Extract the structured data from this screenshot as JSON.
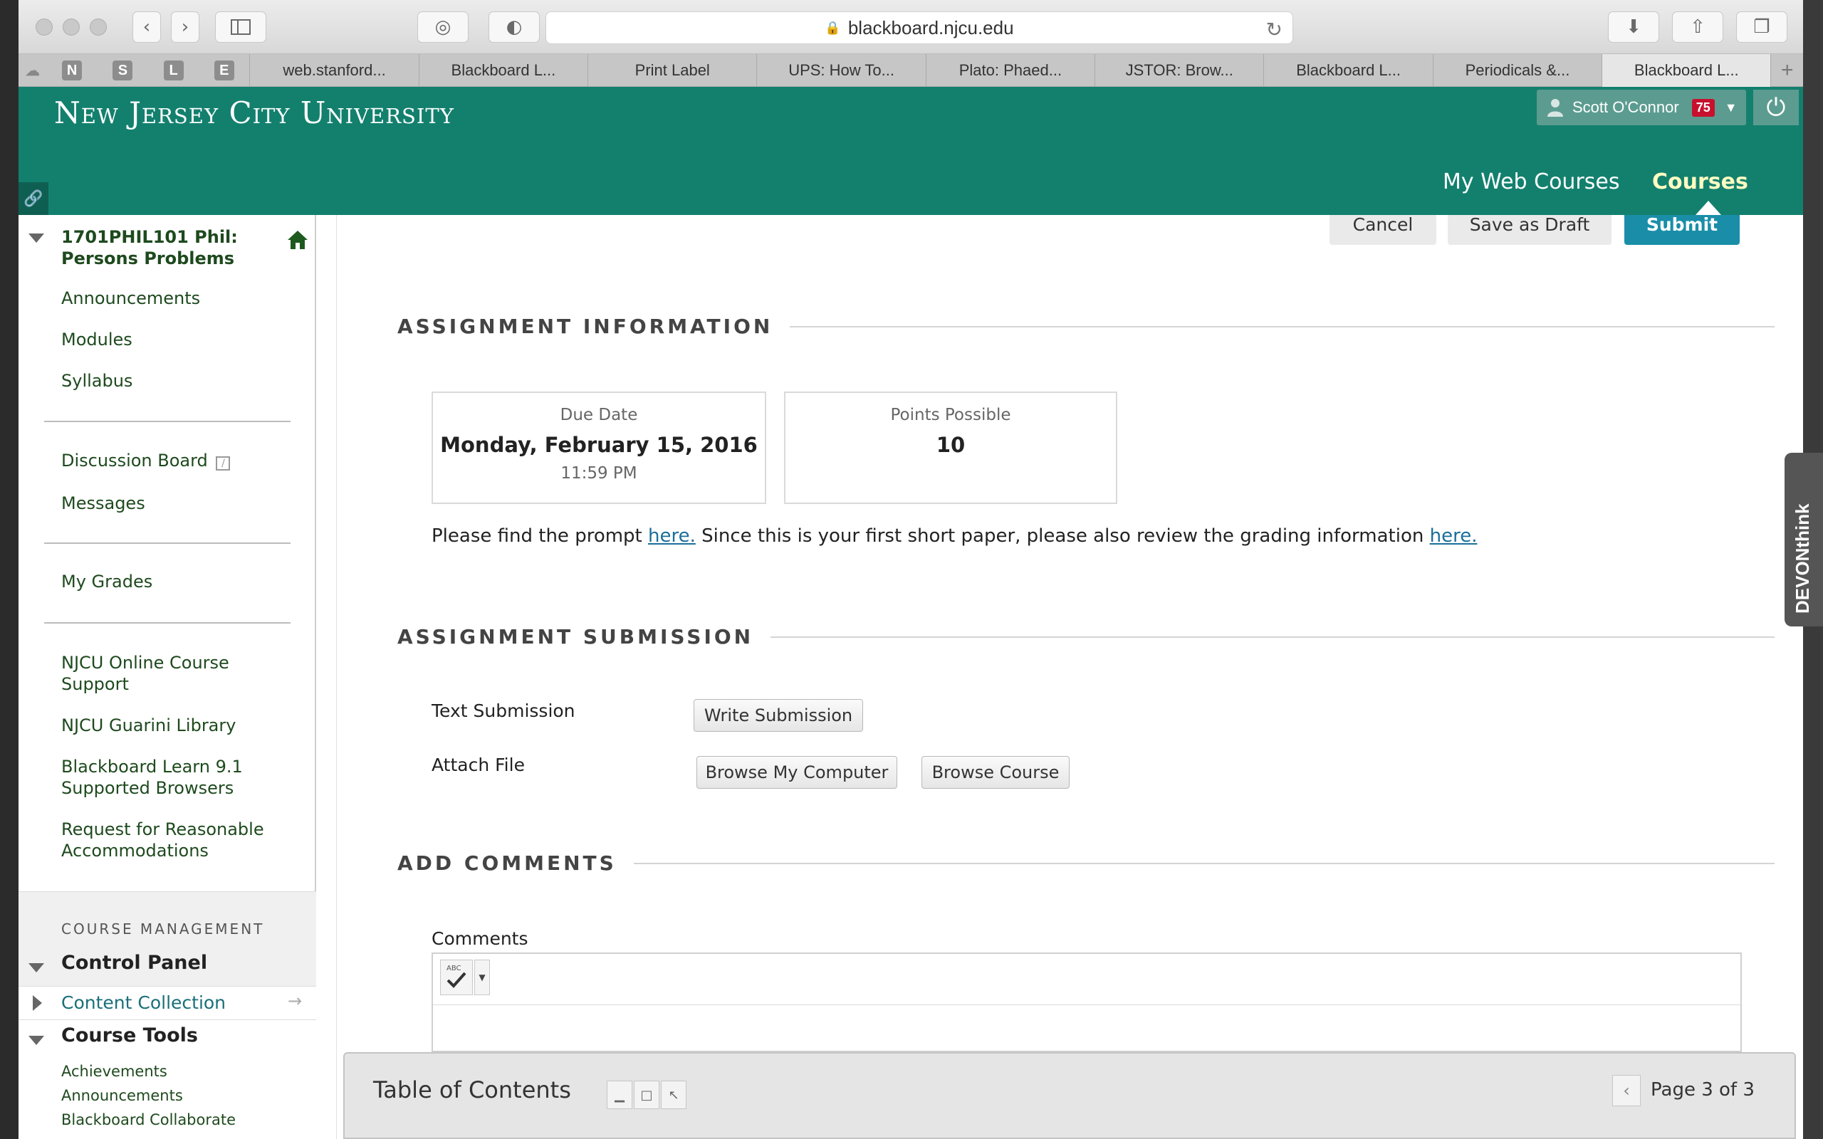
{
  "browser": {
    "url": "blackboard.njcu.edu",
    "pinned_tabs": [
      "N",
      "S",
      "L",
      "E"
    ],
    "tabs": [
      "web.stanford...",
      "Blackboard L...",
      "Print Label",
      "UPS: How To...",
      "Plato: Phaed...",
      "JSTOR: Brow...",
      "Blackboard L...",
      "Periodicals &...",
      "Blackboard L..."
    ],
    "active_tab_index": 8,
    "new_tab_label": "+"
  },
  "banner": {
    "logo": "New Jersey City University",
    "user_name": "Scott O'Connor",
    "notification_count": "75",
    "nav": [
      "My Web Courses",
      "Courses"
    ],
    "active_nav": "Courses",
    "brand_color": "#13806e"
  },
  "sidebar": {
    "course_title": "1701PHIL101 Phil: Persons Problems",
    "group1": [
      "Announcements",
      "Modules",
      "Syllabus"
    ],
    "group2": [
      "Discussion Board",
      "Messages"
    ],
    "group3": [
      "My Grades"
    ],
    "group4": [
      "NJCU Online Course Support",
      "NJCU Guarini Library",
      "Blackboard Learn 9.1 Supported Browsers",
      "Request for Reasonable Accommodations"
    ],
    "management_label": "COURSE MANAGEMENT",
    "control_panel": "Control Panel",
    "content_collection": "Content Collection",
    "course_tools": "Course Tools",
    "tools": [
      "Achievements",
      "Announcements",
      "Blackboard Collaborate"
    ]
  },
  "actions": {
    "cancel": "Cancel",
    "save_draft": "Save as Draft",
    "submit": "Submit"
  },
  "assignment_info": {
    "heading": "ASSIGNMENT INFORMATION",
    "due_label": "Due Date",
    "due_date": "Monday, February 15, 2016",
    "due_time": "11:59 PM",
    "points_label": "Points Possible",
    "points": "10",
    "prompt_before": "Please find the prompt ",
    "link1": "here.",
    "prompt_middle": " Since this is your first short paper, please also review the grading information ",
    "link2": "here."
  },
  "submission": {
    "heading": "ASSIGNMENT SUBMISSION",
    "text_label": "Text Submission",
    "write_button": "Write Submission",
    "attach_label": "Attach File",
    "browse_computer": "Browse My Computer",
    "browse_course": "Browse Course"
  },
  "comments": {
    "heading": "ADD COMMENTS",
    "label": "Comments"
  },
  "toc": {
    "title": "Table of Contents",
    "page": "Page 3 of 3"
  },
  "devonthink": "DEVONthink"
}
